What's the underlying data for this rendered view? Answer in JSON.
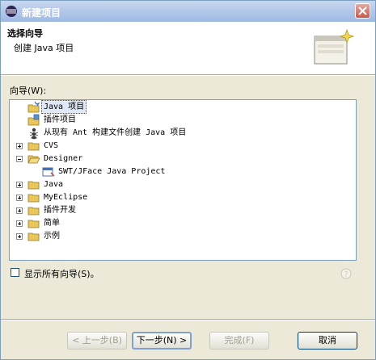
{
  "window": {
    "title": "新建项目"
  },
  "header": {
    "title": "选择向导",
    "description": "创建 Java 项目"
  },
  "wizards_label": "向导(W):",
  "tree": [
    {
      "label": "Java 项目",
      "icon": "java-project-icon",
      "selected": true
    },
    {
      "label": "插件项目",
      "icon": "plugin-project-icon"
    },
    {
      "label": "从现有 Ant 构建文件创建 Java 项目",
      "icon": "ant-icon"
    },
    {
      "label": "CVS",
      "icon": "folder-icon"
    },
    {
      "label": "Designer",
      "icon": "folder-open-icon"
    },
    {
      "label": "SWT/JFace Java Project",
      "icon": "swt-project-icon"
    },
    {
      "label": "Java",
      "icon": "folder-icon"
    },
    {
      "label": "MyEclipse",
      "icon": "folder-icon"
    },
    {
      "label": "插件开发",
      "icon": "folder-icon"
    },
    {
      "label": "简单",
      "icon": "folder-icon"
    },
    {
      "label": "示例",
      "icon": "folder-icon"
    }
  ],
  "show_all_label": "显示所有向导(S)。",
  "buttons": {
    "back": "< 上一步(B)",
    "next": "下一步(N) >",
    "finish": "完成(F)",
    "cancel": "取消"
  },
  "colors": {
    "selection": "#dfe8f6",
    "folder": "#e8c65a"
  }
}
